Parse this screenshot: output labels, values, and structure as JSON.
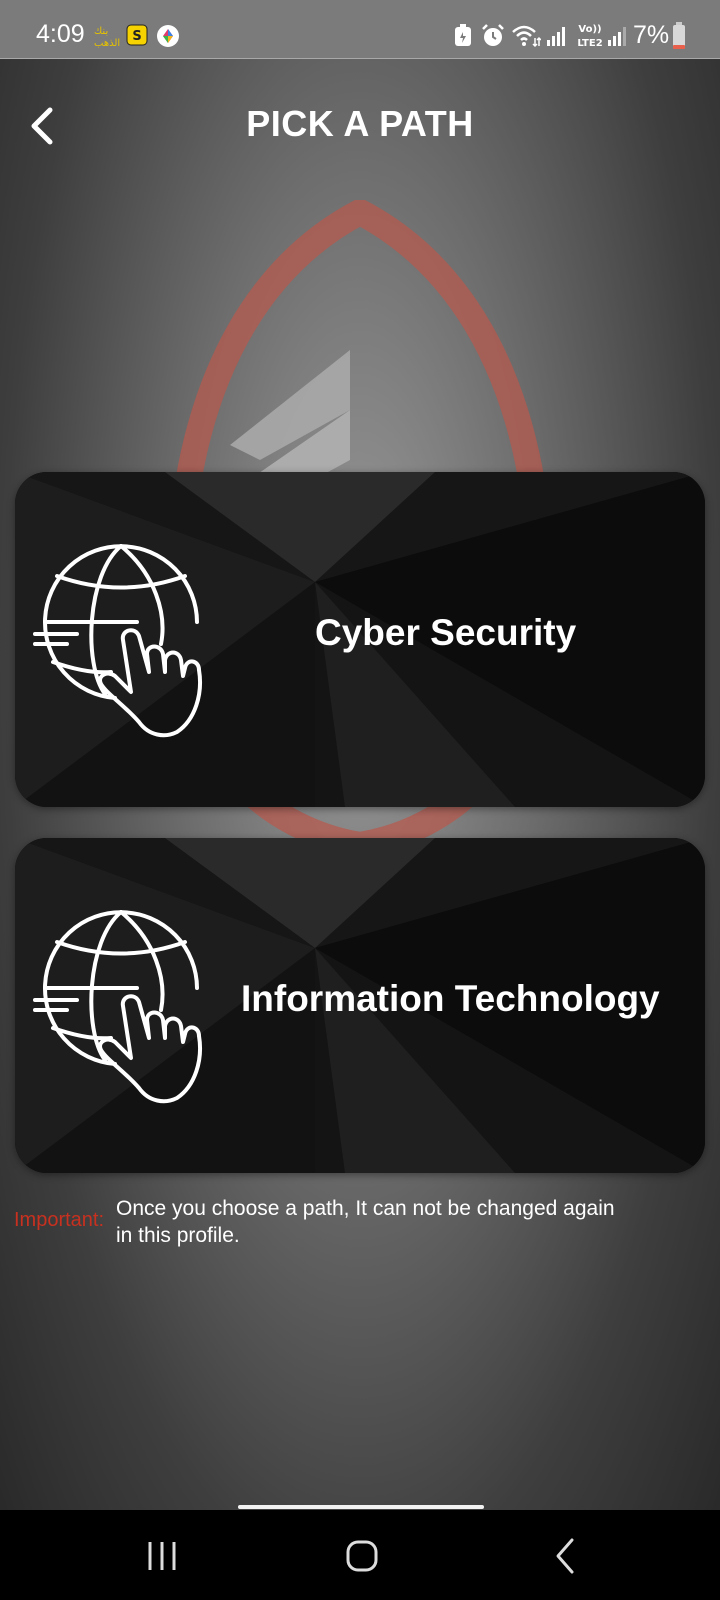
{
  "status_bar": {
    "time": "4:09",
    "battery_percent": "7%",
    "icons": [
      "app-notification-icon",
      "s-app-icon",
      "gallery-icon",
      "battery-saver-icon",
      "alarm-icon",
      "wifi-icon",
      "signal-icon",
      "volte-icon",
      "signal-icon",
      "battery-icon"
    ],
    "volte_label": "Vo))",
    "lte_label": "LTE2"
  },
  "header": {
    "title": "PICK A PATH",
    "back_icon": "chevron-left-icon"
  },
  "paths": [
    {
      "label": "Cyber Security",
      "icon": "globe-touch-icon"
    },
    {
      "label": "Information Technology",
      "icon": "globe-touch-icon"
    }
  ],
  "notice": {
    "prefix": "Important:",
    "text": "Once you choose a path, It can not be changed again in this profile."
  },
  "nav": {
    "icons": [
      "recent-apps-icon",
      "home-icon",
      "back-icon"
    ]
  },
  "colors": {
    "accent_red": "#c8301f",
    "card_bg": "#101010",
    "text": "#ffffff"
  }
}
